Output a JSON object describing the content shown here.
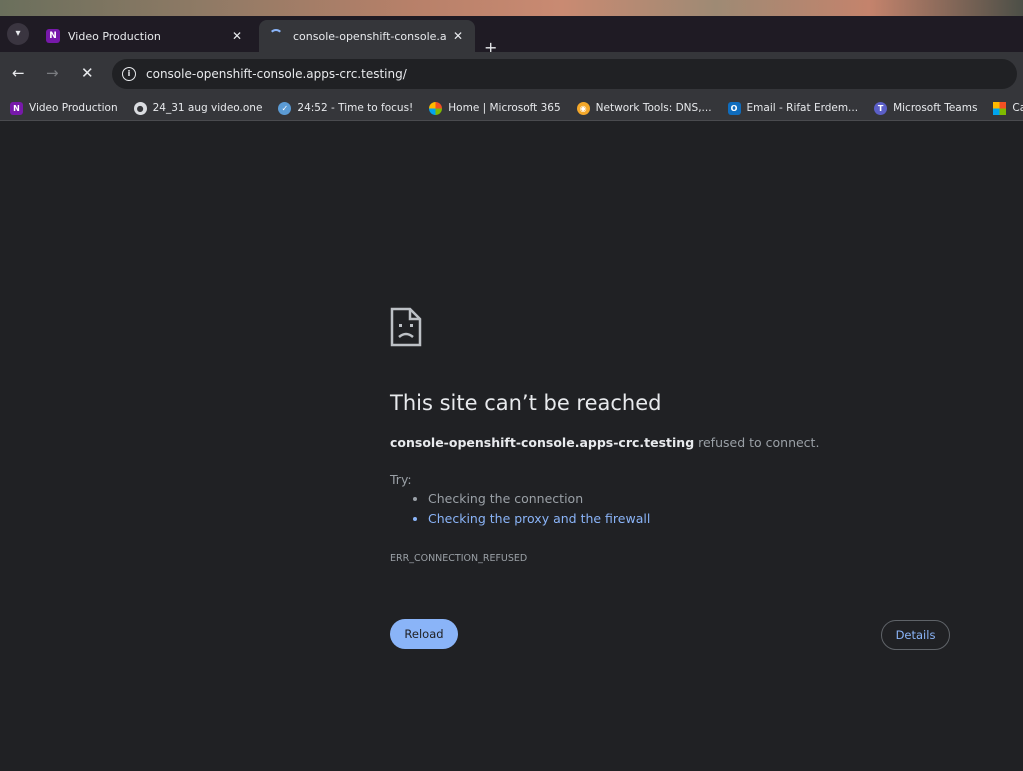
{
  "tabs": [
    {
      "title": "Video Production",
      "icon": "onenote-icon"
    },
    {
      "title": "console-openshift-console.app",
      "icon": "loading-spinner-icon",
      "active": true
    }
  ],
  "toolbar": {
    "url": "console-openshift-console.apps-crc.testing/"
  },
  "bookmarks": [
    {
      "label": "Video Production",
      "icon": "onenote-icon"
    },
    {
      "label": "24_31 aug video.one",
      "icon": "globe-icon"
    },
    {
      "label": "24:52 - Time to focus!",
      "icon": "check-circle-icon"
    },
    {
      "label": "Home | Microsoft 365",
      "icon": "microsoft-365-icon"
    },
    {
      "label": "Network Tools: DNS,...",
      "icon": "network-tools-icon"
    },
    {
      "label": "Email - Rifat Erdem...",
      "icon": "outlook-icon"
    },
    {
      "label": "Microsoft Teams",
      "icon": "teams-icon"
    },
    {
      "label": "Calendar -",
      "icon": "calendar-icon"
    }
  ],
  "error": {
    "title": "This site can’t be reached",
    "host": "console-openshift-console.apps-crc.testing",
    "message": " refused to connect.",
    "try_label": "Try:",
    "suggestions": [
      "Checking the connection",
      "Checking the proxy and the firewall"
    ],
    "code": "ERR_CONNECTION_REFUSED",
    "reload_label": "Reload",
    "details_label": "Details"
  },
  "colors": {
    "accent": "#8ab4f8",
    "background": "#202124",
    "toolbar": "#35363a"
  }
}
